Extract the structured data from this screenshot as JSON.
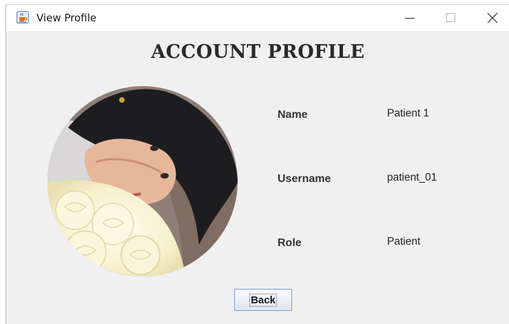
{
  "window": {
    "title": "View Profile",
    "icon": "java-cup-icon",
    "controls": [
      "minimize-icon",
      "maximize-icon",
      "close-icon"
    ]
  },
  "page": {
    "heading": "ACCOUNT PROFILE"
  },
  "profile": {
    "avatar": "profile-photo",
    "fields": [
      {
        "label": "Name",
        "value": "Patient 1"
      },
      {
        "label": "Username",
        "value": "patient_01"
      },
      {
        "label": "Role",
        "value": "Patient"
      }
    ]
  },
  "actions": {
    "back_label": "Back"
  }
}
